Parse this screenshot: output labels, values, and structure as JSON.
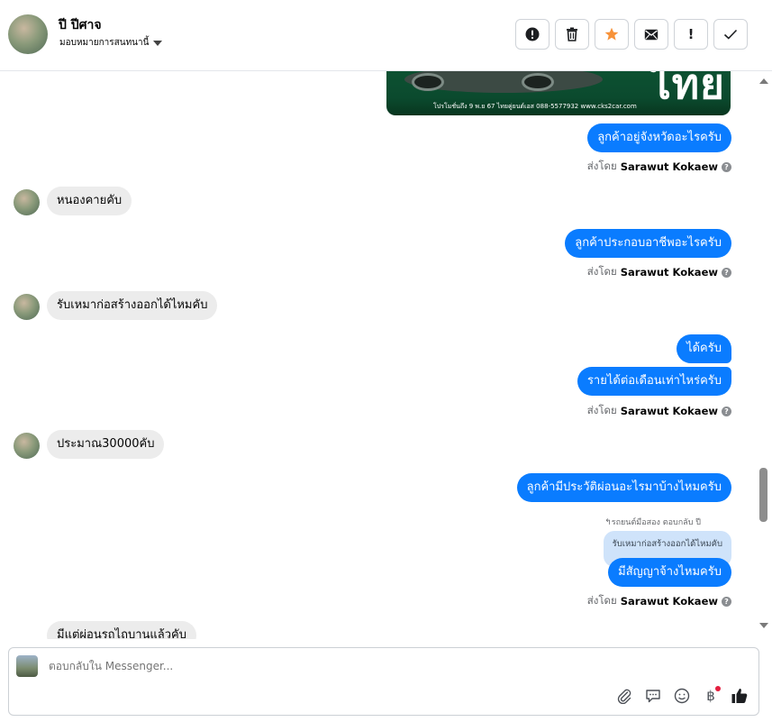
{
  "header": {
    "contact_name": "ปี ปีศาจ",
    "assign_label": "มอบหมายการสนทนานี้",
    "actions": [
      {
        "name": "report-button",
        "icon": "alert-circle-icon",
        "label": "!"
      },
      {
        "name": "delete-button",
        "icon": "trash-icon",
        "label": ""
      },
      {
        "name": "star-button",
        "icon": "star-icon",
        "label": ""
      },
      {
        "name": "mark-unread-button",
        "icon": "envelope-icon",
        "label": ""
      },
      {
        "name": "spam-button",
        "icon": "exclamation-icon",
        "label": "!"
      },
      {
        "name": "done-button",
        "icon": "check-icon",
        "label": "✓"
      }
    ],
    "star_color": "#f7923a"
  },
  "ad": {
    "headline": "ไทย",
    "footer": "โปรโมชั่นถึง 9 พ.ย 67   ไทยคู่ยนต์เอส   088-5577932   www.cks2car.com"
  },
  "messages": {
    "m1": "ลูกค้าอยู่จังหวัดอะไรครับ",
    "m2": "หนองคายคับ",
    "m3": "ลูกค้าประกอบอาชีพอะไรครับ",
    "m4": "รับเหมาก่อสร้างออกได้ไหมคับ",
    "m5": "ได้ครับ",
    "m6": "รายได้ต่อเดือนเท่าไหร่ครับ",
    "m7": "ประมาณ30000คับ",
    "m8": "ลูกค้ามีประวัติผ่อนอะไรมาบ้างไหมครับ",
    "m9_reply_note": "↰รถยนต์มือสอง ตอบกลับ ปี",
    "m9_quote": "รับเหมาก่อสร้างออกได้ไหมคับ",
    "m9": "มีสัญญาจ้างไหมครับ",
    "m10_partial": "มีแต่ผ่อนรถไถบานแล้วคับ"
  },
  "sent_by": {
    "prefix": "ส่งโดย",
    "agent": "Sarawut Kokaew",
    "help_glyph": "?"
  },
  "composer": {
    "placeholder": "ตอบกลับใน Messenger...",
    "tools": [
      "paperclip-icon",
      "chat-bubble-icon",
      "smile-icon",
      "baht-icon",
      "thumbs-up-icon"
    ],
    "baht_glyph": "฿"
  },
  "colors": {
    "outgoing_bubble": "#0a7cff",
    "incoming_bubble": "#ececec",
    "quote_bubble": "#cfe3fa",
    "notification_dot": "#e41e3f"
  }
}
